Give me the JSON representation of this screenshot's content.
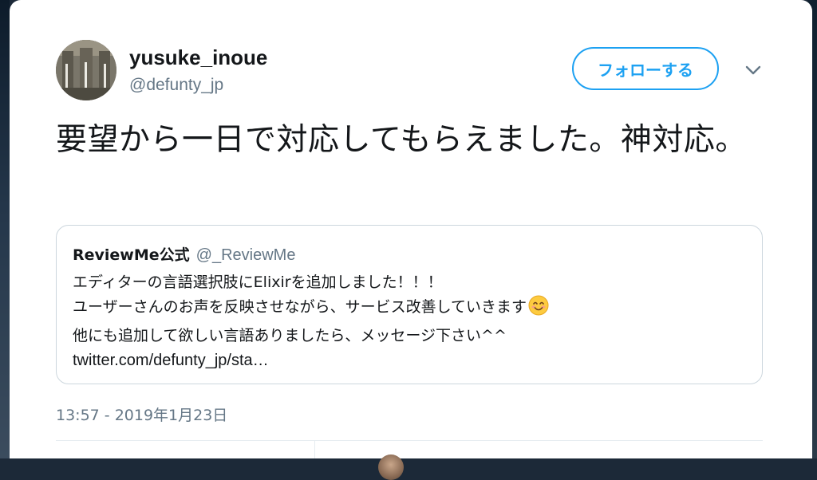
{
  "tweet": {
    "author": {
      "display_name": "yusuke_inoue",
      "handle": "@defunty_jp",
      "avatar_icon": "profile-photo"
    },
    "follow_label": "フォローする",
    "more_icon": "chevron-down-icon",
    "text": "要望から一日で対応してもらえました。神対応。",
    "quoted": {
      "name": "ReviewMe公式",
      "handle": "@_ReviewMe",
      "lines": [
        "エディターの言語選択肢にElixirを追加しました！！！",
        "ユーザーさんのお声を反映させながら、サービス改善していきます",
        "他にも追加して欲しい言語ありましたら、メッセージ下さい^^"
      ],
      "emoji_icon": "smiling-face-emoji",
      "link": "twitter.com/defunty_jp/sta…"
    },
    "timestamp": "13:57 - 2019年1月23日"
  },
  "colors": {
    "accent": "#1da1f2",
    "text": "#14171a",
    "secondary_text": "#657786",
    "border": "#ccd6dd"
  }
}
